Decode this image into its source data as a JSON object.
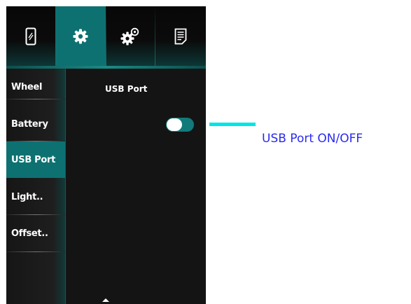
{
  "topbar": {
    "tabs": [
      {
        "icon": "phone-icon",
        "active": false
      },
      {
        "icon": "gear-icon",
        "active": true
      },
      {
        "icon": "gears-icon",
        "active": false
      },
      {
        "icon": "document-icon",
        "active": false
      }
    ]
  },
  "sidebar": {
    "items": [
      {
        "label": "Wheel",
        "active": false
      },
      {
        "label": "Battery",
        "active": false
      },
      {
        "label": "USB Port",
        "active": true
      },
      {
        "label": "Light..",
        "active": false
      },
      {
        "label": "Offset..",
        "active": false
      }
    ]
  },
  "panel": {
    "title": "USB Port",
    "toggle_state": "off"
  },
  "annotation": {
    "text": "USB Port ON/OFF",
    "line_color": "#00e5e5",
    "text_color": "#2a2af0"
  },
  "colors": {
    "accent": "#0e7171",
    "background": "#141414"
  }
}
